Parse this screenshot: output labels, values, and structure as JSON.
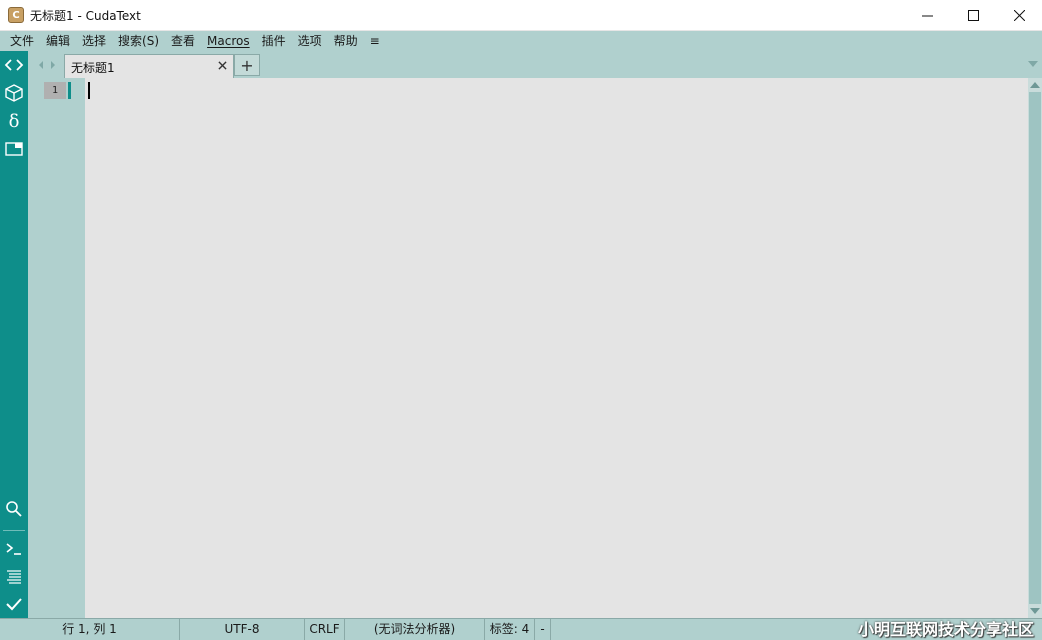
{
  "window": {
    "title": "无标题1 - CudaText",
    "app_icon_letter": "C"
  },
  "menu": {
    "items": [
      "文件",
      "编辑",
      "选择",
      "搜索(S)",
      "查看",
      "Macros",
      "插件",
      "选项",
      "帮助",
      "≡"
    ]
  },
  "tabs": [
    {
      "label": "无标题1",
      "active": true
    }
  ],
  "tab_add_label": "+",
  "editor": {
    "line_numbers": [
      "1"
    ]
  },
  "sidebar": {
    "icons": [
      "code-brackets-icon",
      "cube-icon",
      "delta-icon",
      "panel-icon",
      "search-icon",
      "terminal-icon",
      "list-icon",
      "checkmark-icon"
    ]
  },
  "status": {
    "position": "行 1, 列 1",
    "encoding": "UTF-8",
    "line_ending": "CRLF",
    "lexer": "(无词法分析器)",
    "tab_size": "标签: 4",
    "extra": "-"
  },
  "watermark": "小明互联网技术分享社区",
  "colors": {
    "sidebar": "#0e8e8a",
    "chrome": "#b0d0ce",
    "editor_bg": "#e4e4e4"
  }
}
